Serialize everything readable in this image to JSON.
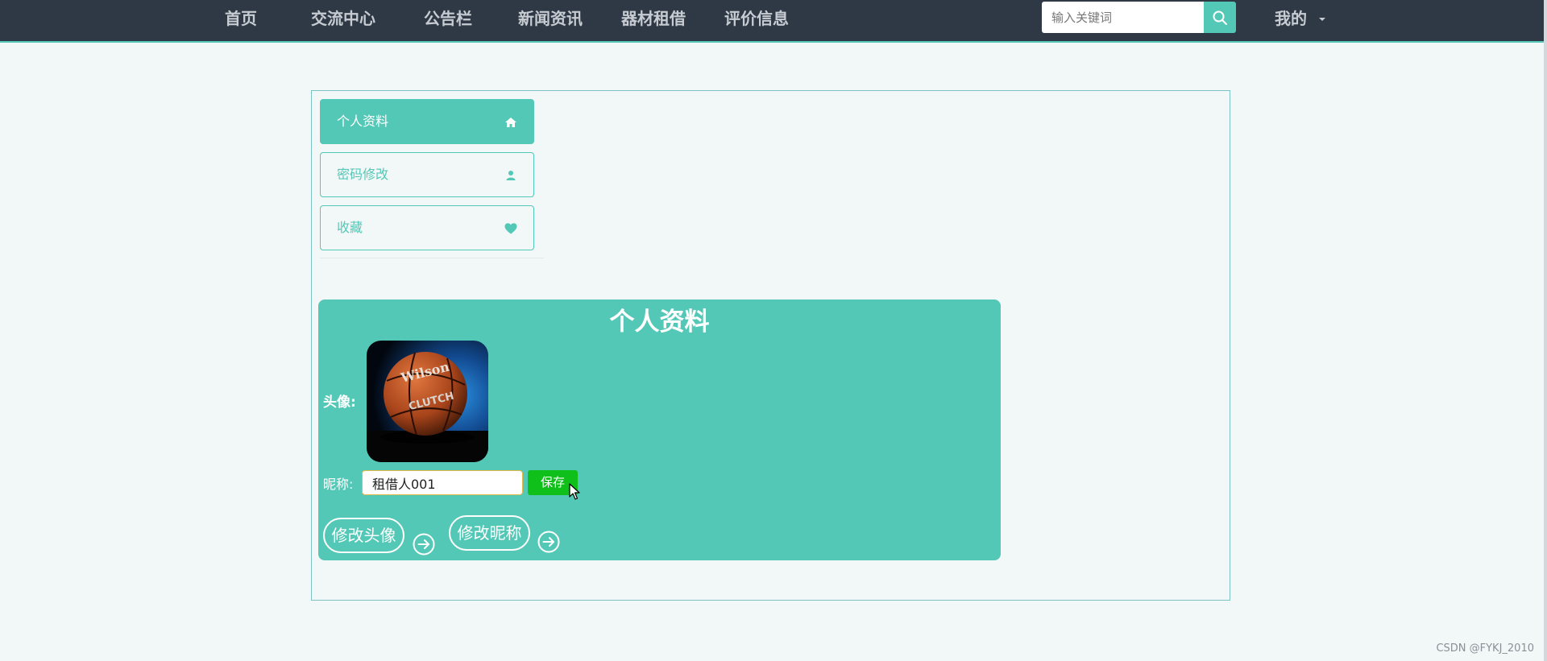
{
  "nav": {
    "items": [
      "首页",
      "交流中心",
      "公告栏",
      "新闻资讯",
      "器材租借",
      "评价信息"
    ],
    "search_placeholder": "输入关键词",
    "mine_label": "我的"
  },
  "sidebar": {
    "items": [
      {
        "label": "个人资料",
        "icon": "home-icon",
        "active": true
      },
      {
        "label": "密码修改",
        "icon": "user-icon",
        "active": false
      },
      {
        "label": "收藏",
        "icon": "heart-icon",
        "active": false
      }
    ]
  },
  "profile": {
    "title": "个人资料",
    "avatar_label": "头像:",
    "avatar_image": "basketball",
    "nickname_label": "昵称:",
    "nickname_value": "租借人001",
    "save_label": "保存",
    "change_avatar_label": "修改头像",
    "change_nickname_label": "修改昵称"
  },
  "watermark": "CSDN @FYKJ_2010",
  "colors": {
    "accent": "#54c8b6",
    "nav_bg": "#2f3945",
    "save_green": "#0fbf1a",
    "page_bg": "#f2f7f8"
  }
}
